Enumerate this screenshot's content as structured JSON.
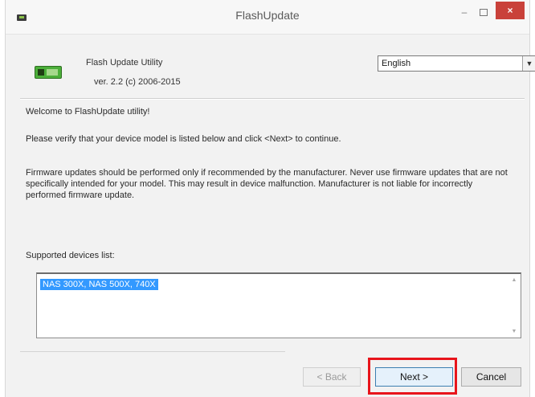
{
  "window": {
    "title": "FlashUpdate",
    "min_label": "–",
    "close_label": "×"
  },
  "header": {
    "utility_name": "Flash Update Utility",
    "version": "ver. 2.2 (c) 2006-2015",
    "language": {
      "selected": "English",
      "arrow": "▼"
    }
  },
  "body": {
    "welcome": "Welcome to FlashUpdate utility!",
    "verify": "Please verify that your device model is listed below and click <Next> to continue.",
    "warning": "Firmware updates should be performed only if recommended by the manufacturer. Never use firmware updates that are not specifically intended for your model. This may result in device malfunction. Manufacturer is not liable for incorrectly performed firmware update.",
    "devices_label": "Supported devices list:",
    "devices": [
      "NAS 300X, NAS 500X, 740X"
    ],
    "scroll_up": "▲",
    "scroll_down": "▼"
  },
  "buttons": {
    "back": "< Back",
    "next": "Next >",
    "cancel": "Cancel"
  },
  "colors": {
    "highlight": "#e8141b",
    "selection": "#3399ff",
    "close_button": "#c9413a"
  }
}
